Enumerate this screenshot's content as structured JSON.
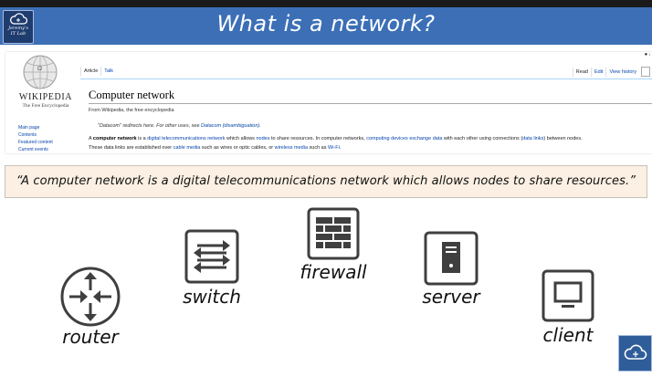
{
  "banner": {
    "title": "What is a network?",
    "logo_line1": "Jeremy's",
    "logo_line2": "IT Lab",
    "logo_icon": "cloud-network-icon"
  },
  "wikipedia": {
    "wordmark": "WIKIPEDIA",
    "tagline": "The Free Encyclopedia",
    "side_links": [
      "Main page",
      "Contents",
      "Featured content",
      "Current events"
    ],
    "tabs_left": [
      "Article",
      "Talk"
    ],
    "tabs_right": [
      "Read",
      "Edit",
      "View history"
    ],
    "heading": "Computer network",
    "from": "From Wikipedia, the free encyclopedia",
    "hatnote_pre": "\"Datacom\" redirects here. For other uses, see ",
    "hatnote_link": "Datacom (disambiguation)",
    "hatnote_post": ".",
    "para": {
      "p1": "A ",
      "b1": "computer network",
      "p2": " is a ",
      "l1": "digital telecommunications network",
      "p3": " which allows ",
      "l2": "nodes",
      "p4": " to share resources. In computer networks, ",
      "l3": "computing devices exchange data",
      "p5": " with each other using connections (",
      "l4": "data links",
      "p6": ") between nodes.",
      "p7": "These data links are established over ",
      "l5": "cable media",
      "p8": " such as wires or optic cables, or ",
      "l6": "wireless media",
      "p9": " such as ",
      "l7": "Wi-Fi",
      "p10": "."
    }
  },
  "quote": "“A computer network is a digital telecommunications network which allows nodes to share resources.”",
  "devices": [
    {
      "name": "router",
      "icon": "router-icon"
    },
    {
      "name": "switch",
      "icon": "switch-icon"
    },
    {
      "name": "firewall",
      "icon": "firewall-icon"
    },
    {
      "name": "server",
      "icon": "server-icon"
    },
    {
      "name": "client",
      "icon": "client-icon"
    }
  ],
  "colors": {
    "banner": "#3c6fb6",
    "quote_bg": "#fbf0e3",
    "device": "#3f3f3f"
  }
}
